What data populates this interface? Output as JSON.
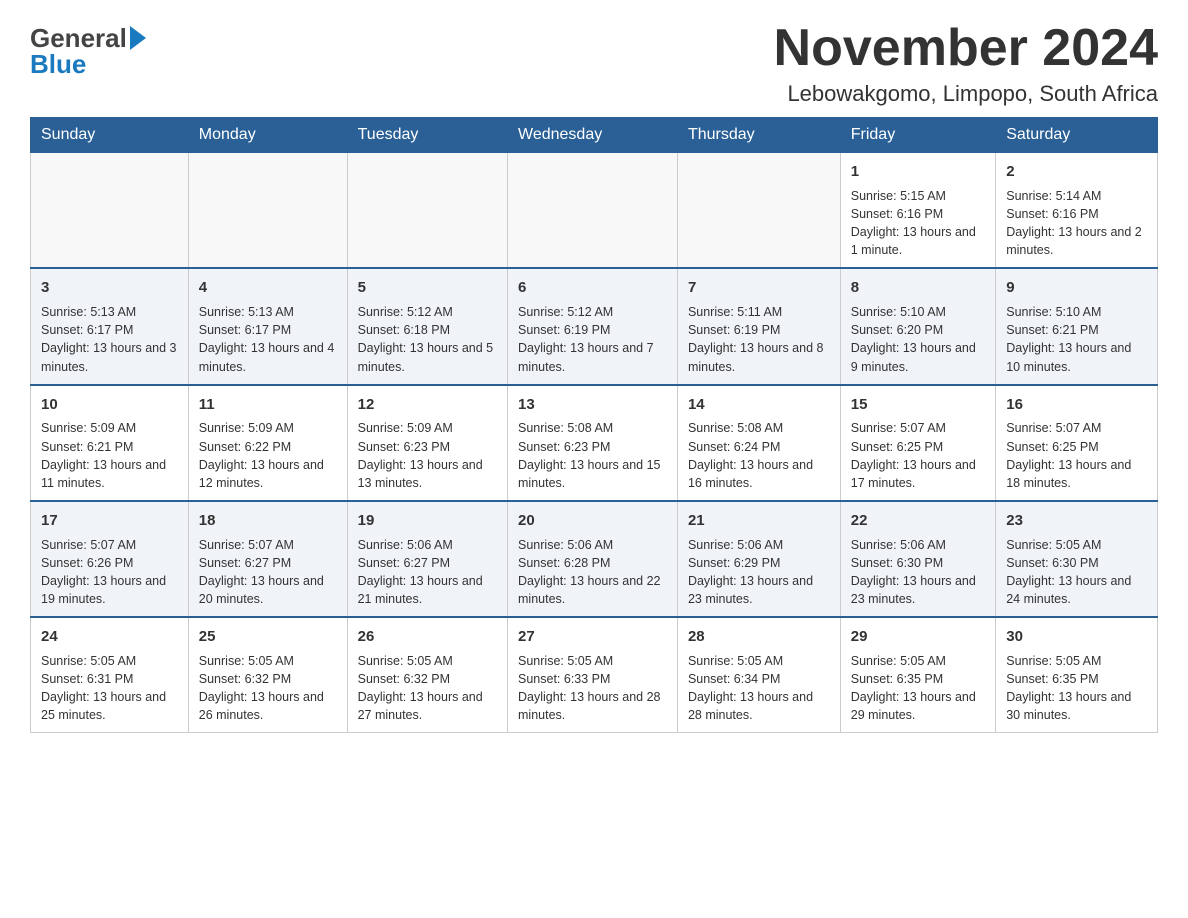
{
  "header": {
    "logo_general": "General",
    "logo_blue": "Blue",
    "title": "November 2024",
    "subtitle": "Lebowakgomo, Limpopo, South Africa"
  },
  "calendar": {
    "days_of_week": [
      "Sunday",
      "Monday",
      "Tuesday",
      "Wednesday",
      "Thursday",
      "Friday",
      "Saturday"
    ],
    "weeks": [
      [
        {
          "day": "",
          "info": ""
        },
        {
          "day": "",
          "info": ""
        },
        {
          "day": "",
          "info": ""
        },
        {
          "day": "",
          "info": ""
        },
        {
          "day": "",
          "info": ""
        },
        {
          "day": "1",
          "info": "Sunrise: 5:15 AM\nSunset: 6:16 PM\nDaylight: 13 hours and 1 minute."
        },
        {
          "day": "2",
          "info": "Sunrise: 5:14 AM\nSunset: 6:16 PM\nDaylight: 13 hours and 2 minutes."
        }
      ],
      [
        {
          "day": "3",
          "info": "Sunrise: 5:13 AM\nSunset: 6:17 PM\nDaylight: 13 hours and 3 minutes."
        },
        {
          "day": "4",
          "info": "Sunrise: 5:13 AM\nSunset: 6:17 PM\nDaylight: 13 hours and 4 minutes."
        },
        {
          "day": "5",
          "info": "Sunrise: 5:12 AM\nSunset: 6:18 PM\nDaylight: 13 hours and 5 minutes."
        },
        {
          "day": "6",
          "info": "Sunrise: 5:12 AM\nSunset: 6:19 PM\nDaylight: 13 hours and 7 minutes."
        },
        {
          "day": "7",
          "info": "Sunrise: 5:11 AM\nSunset: 6:19 PM\nDaylight: 13 hours and 8 minutes."
        },
        {
          "day": "8",
          "info": "Sunrise: 5:10 AM\nSunset: 6:20 PM\nDaylight: 13 hours and 9 minutes."
        },
        {
          "day": "9",
          "info": "Sunrise: 5:10 AM\nSunset: 6:21 PM\nDaylight: 13 hours and 10 minutes."
        }
      ],
      [
        {
          "day": "10",
          "info": "Sunrise: 5:09 AM\nSunset: 6:21 PM\nDaylight: 13 hours and 11 minutes."
        },
        {
          "day": "11",
          "info": "Sunrise: 5:09 AM\nSunset: 6:22 PM\nDaylight: 13 hours and 12 minutes."
        },
        {
          "day": "12",
          "info": "Sunrise: 5:09 AM\nSunset: 6:23 PM\nDaylight: 13 hours and 13 minutes."
        },
        {
          "day": "13",
          "info": "Sunrise: 5:08 AM\nSunset: 6:23 PM\nDaylight: 13 hours and 15 minutes."
        },
        {
          "day": "14",
          "info": "Sunrise: 5:08 AM\nSunset: 6:24 PM\nDaylight: 13 hours and 16 minutes."
        },
        {
          "day": "15",
          "info": "Sunrise: 5:07 AM\nSunset: 6:25 PM\nDaylight: 13 hours and 17 minutes."
        },
        {
          "day": "16",
          "info": "Sunrise: 5:07 AM\nSunset: 6:25 PM\nDaylight: 13 hours and 18 minutes."
        }
      ],
      [
        {
          "day": "17",
          "info": "Sunrise: 5:07 AM\nSunset: 6:26 PM\nDaylight: 13 hours and 19 minutes."
        },
        {
          "day": "18",
          "info": "Sunrise: 5:07 AM\nSunset: 6:27 PM\nDaylight: 13 hours and 20 minutes."
        },
        {
          "day": "19",
          "info": "Sunrise: 5:06 AM\nSunset: 6:27 PM\nDaylight: 13 hours and 21 minutes."
        },
        {
          "day": "20",
          "info": "Sunrise: 5:06 AM\nSunset: 6:28 PM\nDaylight: 13 hours and 22 minutes."
        },
        {
          "day": "21",
          "info": "Sunrise: 5:06 AM\nSunset: 6:29 PM\nDaylight: 13 hours and 23 minutes."
        },
        {
          "day": "22",
          "info": "Sunrise: 5:06 AM\nSunset: 6:30 PM\nDaylight: 13 hours and 23 minutes."
        },
        {
          "day": "23",
          "info": "Sunrise: 5:05 AM\nSunset: 6:30 PM\nDaylight: 13 hours and 24 minutes."
        }
      ],
      [
        {
          "day": "24",
          "info": "Sunrise: 5:05 AM\nSunset: 6:31 PM\nDaylight: 13 hours and 25 minutes."
        },
        {
          "day": "25",
          "info": "Sunrise: 5:05 AM\nSunset: 6:32 PM\nDaylight: 13 hours and 26 minutes."
        },
        {
          "day": "26",
          "info": "Sunrise: 5:05 AM\nSunset: 6:32 PM\nDaylight: 13 hours and 27 minutes."
        },
        {
          "day": "27",
          "info": "Sunrise: 5:05 AM\nSunset: 6:33 PM\nDaylight: 13 hours and 28 minutes."
        },
        {
          "day": "28",
          "info": "Sunrise: 5:05 AM\nSunset: 6:34 PM\nDaylight: 13 hours and 28 minutes."
        },
        {
          "day": "29",
          "info": "Sunrise: 5:05 AM\nSunset: 6:35 PM\nDaylight: 13 hours and 29 minutes."
        },
        {
          "day": "30",
          "info": "Sunrise: 5:05 AM\nSunset: 6:35 PM\nDaylight: 13 hours and 30 minutes."
        }
      ]
    ]
  }
}
